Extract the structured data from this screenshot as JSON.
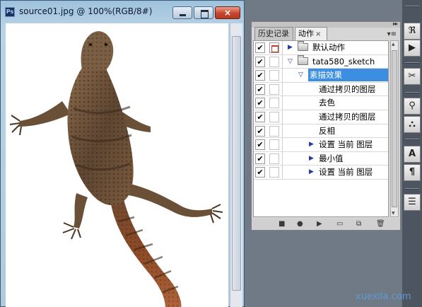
{
  "document": {
    "app_badge": "Ps",
    "title": "source01.jpg @ 100%(RGB/8#)",
    "close_glyph": "×",
    "image_description": "lizard photo on white background"
  },
  "actions_panel": {
    "tabs": [
      {
        "label": "历史记录",
        "active": false
      },
      {
        "label": "动作",
        "active": true,
        "close": "×"
      }
    ],
    "collapse_glyph": "▸▸",
    "menu_glyph": "▾≡",
    "rows": [
      {
        "checked": true,
        "dialog": true,
        "indent": 0,
        "expander": "collapsed",
        "folder": true,
        "label": "默认动作",
        "selected": false
      },
      {
        "checked": true,
        "dialog": false,
        "indent": 0,
        "expander": "expanded",
        "folder": true,
        "label": "tata580_sketch",
        "selected": false
      },
      {
        "checked": true,
        "dialog": false,
        "indent": 1,
        "expander": "expanded",
        "folder": false,
        "label": "素描效果",
        "selected": true
      },
      {
        "checked": true,
        "dialog": false,
        "indent": 2,
        "expander": "none",
        "folder": false,
        "label": "通过拷贝的图层",
        "selected": false
      },
      {
        "checked": true,
        "dialog": false,
        "indent": 2,
        "expander": "none",
        "folder": false,
        "label": "去色",
        "selected": false
      },
      {
        "checked": true,
        "dialog": false,
        "indent": 2,
        "expander": "none",
        "folder": false,
        "label": "通过拷贝的图层",
        "selected": false
      },
      {
        "checked": true,
        "dialog": false,
        "indent": 2,
        "expander": "none",
        "folder": false,
        "label": "反相",
        "selected": false
      },
      {
        "checked": true,
        "dialog": true,
        "indent": 2,
        "expander": "collapsed",
        "folder": false,
        "label": "设置 当前 图层",
        "selected": false
      },
      {
        "checked": true,
        "dialog": true,
        "indent": 2,
        "expander": "collapsed",
        "folder": false,
        "label": "最小值",
        "selected": false
      },
      {
        "checked": true,
        "dialog": true,
        "indent": 2,
        "expander": "collapsed",
        "folder": false,
        "label": "设置 当前 图层",
        "selected": false
      }
    ],
    "check_glyph": "✔",
    "bottom_buttons": [
      {
        "name": "stop-button",
        "glyph": "■"
      },
      {
        "name": "record-button",
        "glyph": "●"
      },
      {
        "name": "play-button",
        "glyph": "▶"
      },
      {
        "name": "new-set-button",
        "glyph": "▭"
      },
      {
        "name": "new-action-button",
        "glyph": "⧉"
      },
      {
        "name": "delete-button",
        "glyph": "🗑"
      }
    ]
  },
  "tool_strip": [
    {
      "name": "history-brush-icon",
      "glyph": "ℜ"
    },
    {
      "name": "actions-panel-icon",
      "glyph": "▶"
    },
    {
      "name": "tools-icon",
      "glyph": "✂"
    },
    {
      "name": "clone-source-icon",
      "glyph": "⚲"
    },
    {
      "name": "stamp-icon",
      "glyph": "⛬"
    },
    {
      "name": "character-icon",
      "glyph": "A"
    },
    {
      "name": "paragraph-icon",
      "glyph": "¶"
    },
    {
      "name": "notes-icon",
      "glyph": "☰"
    }
  ],
  "watermark": "xuexila.com",
  "colors": {
    "selection": "#3c8ee0",
    "titlebar": "#a8c8e0",
    "close_button": "#c8452d"
  }
}
